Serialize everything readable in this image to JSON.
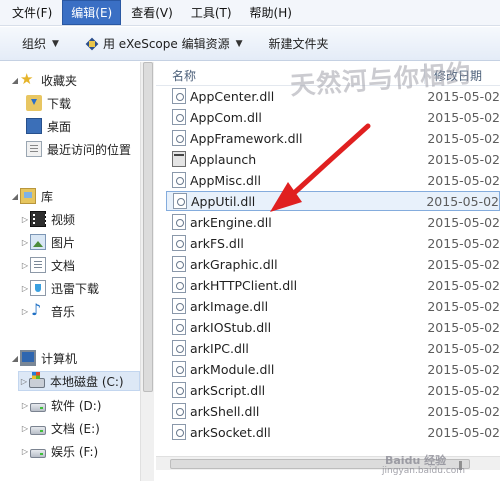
{
  "menu": [
    "文件(F)",
    "编辑(E)",
    "查看(V)",
    "工具(T)",
    "帮助(H)"
  ],
  "toolbar": {
    "organize": "组织",
    "open_with": "用 eXeScope 编辑资源",
    "new_folder": "新建文件夹"
  },
  "nav": {
    "favorites": "收藏夹",
    "downloads": "下载",
    "desktop": "桌面",
    "recent": "最近访问的位置",
    "library": "库",
    "video": "视频",
    "pictures": "图片",
    "documents": "文档",
    "xunlei": "迅雷下载",
    "music": "音乐",
    "computer": "计算机",
    "drive_c": "本地磁盘 (C:)",
    "drive_d": "软件 (D:)",
    "drive_e": "文档 (E:)",
    "drive_f": "娱乐 (F:)"
  },
  "columns": {
    "name": "名称",
    "date": "修改日期"
  },
  "files": [
    {
      "name": "AppCenter.dll",
      "date": "2015-05-02",
      "type": "dll"
    },
    {
      "name": "AppCom.dll",
      "date": "2015-05-02",
      "type": "dll"
    },
    {
      "name": "AppFramework.dll",
      "date": "2015-05-02",
      "type": "dll"
    },
    {
      "name": "Applaunch",
      "date": "2015-05-02",
      "type": "app"
    },
    {
      "name": "AppMisc.dll",
      "date": "2015-05-02",
      "type": "dll"
    },
    {
      "name": "AppUtil.dll",
      "date": "2015-05-02",
      "type": "dll",
      "selected": true
    },
    {
      "name": "arkEngine.dll",
      "date": "2015-05-02",
      "type": "dll"
    },
    {
      "name": "arkFS.dll",
      "date": "2015-05-02",
      "type": "dll"
    },
    {
      "name": "arkGraphic.dll",
      "date": "2015-05-02",
      "type": "dll"
    },
    {
      "name": "arkHTTPClient.dll",
      "date": "2015-05-02",
      "type": "dll"
    },
    {
      "name": "arkImage.dll",
      "date": "2015-05-02",
      "type": "dll"
    },
    {
      "name": "arkIOStub.dll",
      "date": "2015-05-02",
      "type": "dll"
    },
    {
      "name": "arkIPC.dll",
      "date": "2015-05-02",
      "type": "dll"
    },
    {
      "name": "arkModule.dll",
      "date": "2015-05-02",
      "type": "dll"
    },
    {
      "name": "arkScript.dll",
      "date": "2015-05-02",
      "type": "dll"
    },
    {
      "name": "arkShell.dll",
      "date": "2015-05-02",
      "type": "dll"
    },
    {
      "name": "arkSocket.dll",
      "date": "2015-05-02",
      "type": "dll"
    }
  ],
  "watermark": "天然河与你相约",
  "baidu": "Baidu 经验",
  "baidu_url": "jingyan.baidu.com",
  "colors": {
    "menu_active": "#3a6fc4",
    "arrow": "#e02020",
    "selection": "#e8f1fb"
  }
}
